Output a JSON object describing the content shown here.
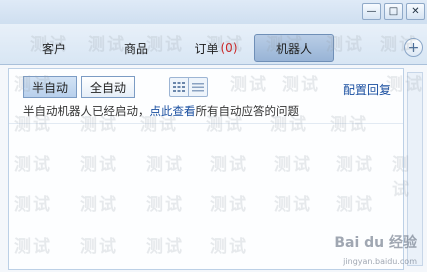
{
  "window_controls": {
    "minimize": "—",
    "maximize": "□",
    "close": "✕"
  },
  "tabs": [
    {
      "label": "客户",
      "badge": ""
    },
    {
      "label": "商品",
      "badge": ""
    },
    {
      "label": "订单",
      "badge": "(0)"
    },
    {
      "label": "机器人",
      "badge": "",
      "active": true
    }
  ],
  "add_tab_icon": "+",
  "mode": {
    "semi_auto": "半自动",
    "full_auto": "全自动",
    "selected": "半自动"
  },
  "config_link": "配置回复",
  "status": {
    "prefix": "半自动机器人已经启动，",
    "link": "点此查看",
    "suffix": "所有自动应答的问题"
  },
  "watermark": {
    "text": "测试",
    "brand": "Bai du 经验",
    "url": "jingyan.baidu.com"
  },
  "colors": {
    "accent": "#98b4d6",
    "link": "#1a4fa0",
    "badge": "#cc2222"
  }
}
